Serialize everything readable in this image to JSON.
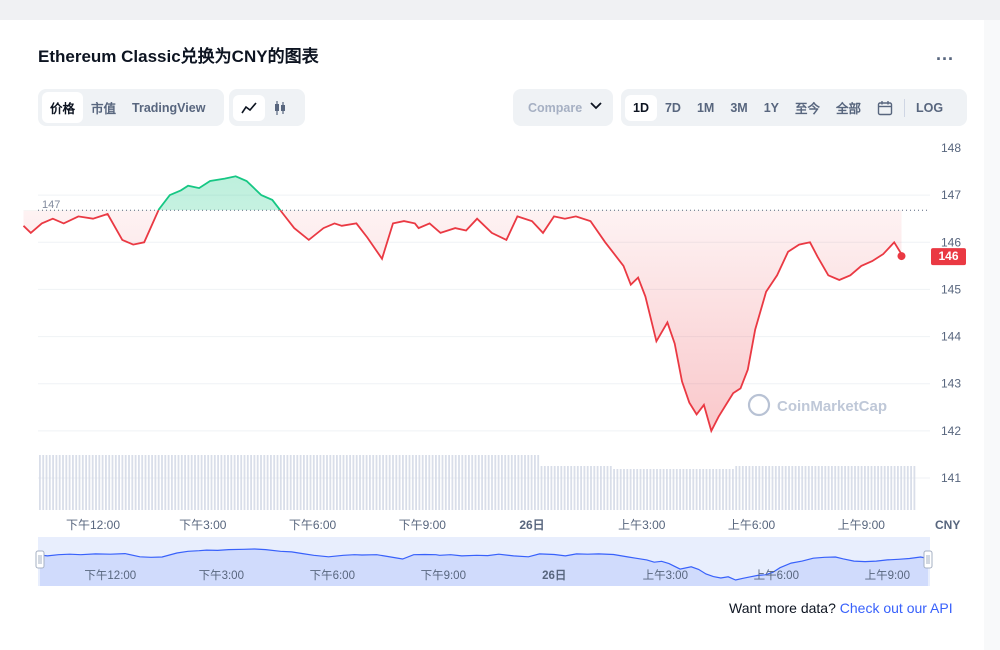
{
  "page": {
    "title": "Ethereum Classic兑换为CNY的图表",
    "more_label": "...",
    "view_tabs": [
      "价格",
      "市值",
      "TradingView"
    ],
    "chart_type_icons": [
      "line-chart-icon",
      "candlestick-icon"
    ],
    "compare_label": "Compare",
    "range_buttons": [
      "1D",
      "7D",
      "1M",
      "3M",
      "1Y",
      "至今",
      "全部"
    ],
    "active_range": "1D",
    "calendar_icon": "calendar-icon",
    "log_label": "LOG",
    "currency_label": "CNY",
    "watermark": "CoinMarketCap",
    "footer_text": "Want more data?",
    "footer_link": "Check out our API",
    "colors": {
      "up": "#16c784",
      "down": "#ea3943",
      "accent": "#3861fb",
      "navigator": "#c9d6fb"
    }
  },
  "chart_data": {
    "type": "line",
    "title": "Ethereum Classic兑换为CNY的图表",
    "xlabel": "",
    "ylabel": "",
    "ylim": [
      141,
      148
    ],
    "y_ticks": [
      "148",
      "147",
      "146",
      "145",
      "144",
      "143",
      "142",
      "141"
    ],
    "x_ticks": [
      "下午12:00",
      "下午3:00",
      "下午6:00",
      "下午9:00",
      "26日",
      "上午3:00",
      "上午6:00",
      "上午9:00"
    ],
    "x_tick_hours": [
      12,
      15,
      18,
      21,
      24,
      27,
      30,
      33
    ],
    "navigator_ticks": [
      "下午12:00",
      "下午3:00",
      "下午6:00",
      "下午9:00",
      "26日",
      "上午3:00",
      "上午6:00",
      "上午9:00"
    ],
    "navigator_tick_hours": [
      12,
      15,
      18,
      21,
      24,
      27,
      30,
      33
    ],
    "reference_value": 146.68,
    "reference_label": "147",
    "current_label": "146",
    "x_hours": [
      10.1,
      10.3,
      10.6,
      10.9,
      11.2,
      11.6,
      12.0,
      12.4,
      12.8,
      13.1,
      13.4,
      13.8,
      14.1,
      14.4,
      14.6,
      14.9,
      15.2,
      15.6,
      15.9,
      16.2,
      16.6,
      16.9,
      17.2,
      17.5,
      17.9,
      18.3,
      18.6,
      18.8,
      19.2,
      19.5,
      19.9,
      20.2,
      20.5,
      20.8,
      20.9,
      21.2,
      21.5,
      21.9,
      22.2,
      22.5,
      22.9,
      23.3,
      23.6,
      24.0,
      24.3,
      24.6,
      24.9,
      25.2,
      25.6,
      26.0,
      26.2,
      26.5,
      26.7,
      26.9,
      27.1,
      27.4,
      27.7,
      27.9,
      28.1,
      28.3,
      28.5,
      28.7,
      28.9,
      29.1,
      29.3,
      29.5,
      29.7,
      29.9,
      30.1,
      30.4,
      30.7,
      31.0,
      31.3,
      31.6,
      31.8,
      32.1,
      32.4,
      32.7,
      33.0,
      33.3,
      33.6,
      33.9,
      34.1
    ],
    "values": [
      146.35,
      146.2,
      146.4,
      146.5,
      146.4,
      146.55,
      146.5,
      146.6,
      146.05,
      145.95,
      146.0,
      146.7,
      147.0,
      147.1,
      147.2,
      147.15,
      147.3,
      147.35,
      147.4,
      147.3,
      147.0,
      146.9,
      146.6,
      146.3,
      146.05,
      146.3,
      146.4,
      146.35,
      146.4,
      146.1,
      145.65,
      146.4,
      146.45,
      146.4,
      146.3,
      146.4,
      146.2,
      146.3,
      146.25,
      146.5,
      146.2,
      146.05,
      146.55,
      146.45,
      146.2,
      146.55,
      146.5,
      146.55,
      146.45,
      146.0,
      145.8,
      145.5,
      145.1,
      145.25,
      144.85,
      143.9,
      144.3,
      143.85,
      143.05,
      142.6,
      142.35,
      142.55,
      142.0,
      142.3,
      142.55,
      142.8,
      142.9,
      143.3,
      144.15,
      144.95,
      145.3,
      145.8,
      145.95,
      146.0,
      145.7,
      145.3,
      145.2,
      145.3,
      145.5,
      145.6,
      145.75,
      146.0,
      145.75
    ],
    "series": [
      {
        "values_key": "values"
      }
    ]
  }
}
